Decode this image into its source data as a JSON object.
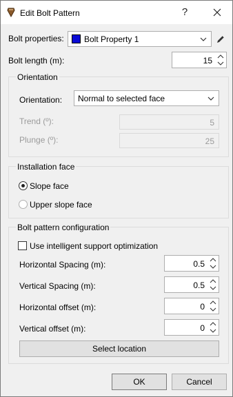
{
  "window": {
    "title": "Edit Bolt Pattern",
    "help_label": "?"
  },
  "bolt_properties": {
    "label": "Bolt properties:",
    "value": "Bolt Property 1",
    "swatch_color": "#0b0bd6"
  },
  "bolt_length": {
    "label": "Bolt length (m):",
    "value": "15"
  },
  "orientation_group": {
    "title": "Orientation",
    "orientation_label": "Orientation:",
    "orientation_value": "Normal to selected face",
    "trend_label": "Trend (º):",
    "trend_value": "5",
    "plunge_label": "Plunge (º):",
    "plunge_value": "25"
  },
  "installation_group": {
    "title": "Installation face",
    "options": [
      {
        "label": "Slope face",
        "selected": true
      },
      {
        "label": "Upper slope face",
        "selected": false
      }
    ]
  },
  "pattern_group": {
    "title": "Bolt pattern configuration",
    "intelligent_label": "Use intelligent support optimization",
    "intelligent_checked": false,
    "fields": [
      {
        "label": "Horizontal Spacing (m):",
        "value": "0.5"
      },
      {
        "label": "Vertical Spacing (m):",
        "value": "0.5"
      },
      {
        "label": "Horizontal offset (m):",
        "value": "0"
      },
      {
        "label": "Vertical offset (m):",
        "value": "0"
      }
    ],
    "select_location_label": "Select location"
  },
  "footer": {
    "ok_label": "OK",
    "cancel_label": "Cancel"
  }
}
